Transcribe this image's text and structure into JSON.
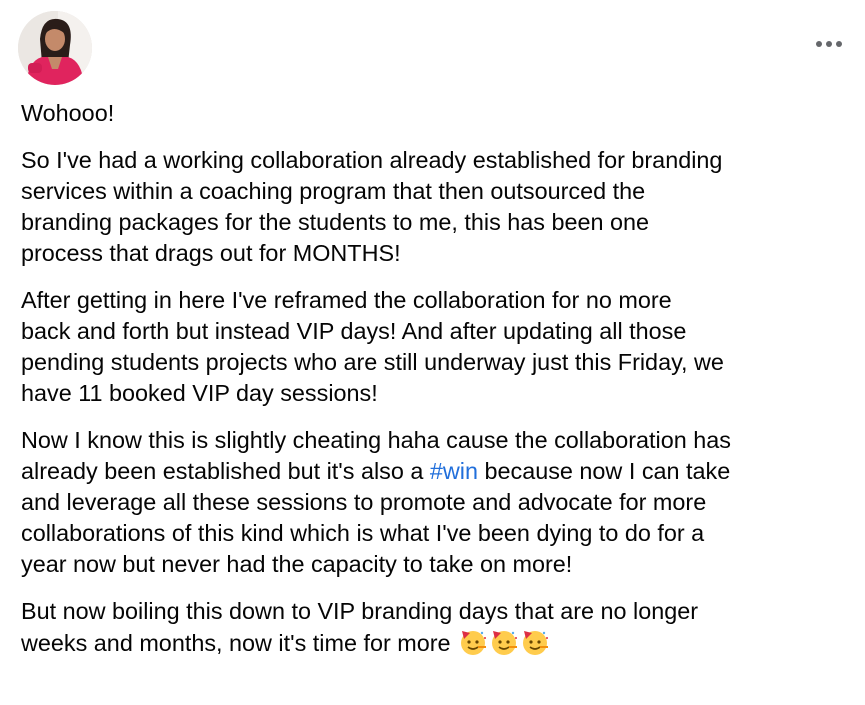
{
  "post": {
    "author_avatar_icon": "profile-photo",
    "menu_icon": "more-horizontal-icon",
    "paragraphs": {
      "p1": "Wohooo!",
      "p2": "So I've had a working collaboration already established for branding\nservices within a coaching program that then outsourced the\nbranding packages for the students to me, this has been one\nprocess that drags out for MONTHS!",
      "p3": "After getting in here I've reframed the collaboration for no more\nback and forth but instead VIP days! And after updating all those\npending students projects who are still underway just this Friday, we\nhave 11 booked VIP day sessions!",
      "p4_before": "Now I know this is slightly cheating haha cause the collaboration has\nalready been established but it's also a ",
      "p4_hashtag": "#win",
      "p4_after": " because now I can take\nand leverage all these sessions to promote and advocate for more\ncollaborations of this kind which is what I've been dying to do for a\nyear now but never had the capacity to take on more!",
      "p5": "But now boiling this down to VIP branding days that are no longer\nweeks and months, now it's time for more "
    },
    "emojis": [
      "partying-face-icon",
      "partying-face-icon",
      "partying-face-icon"
    ],
    "colors": {
      "text": "#050505",
      "hashtag": "#216fdb",
      "menu_dots": "#65676b"
    }
  }
}
